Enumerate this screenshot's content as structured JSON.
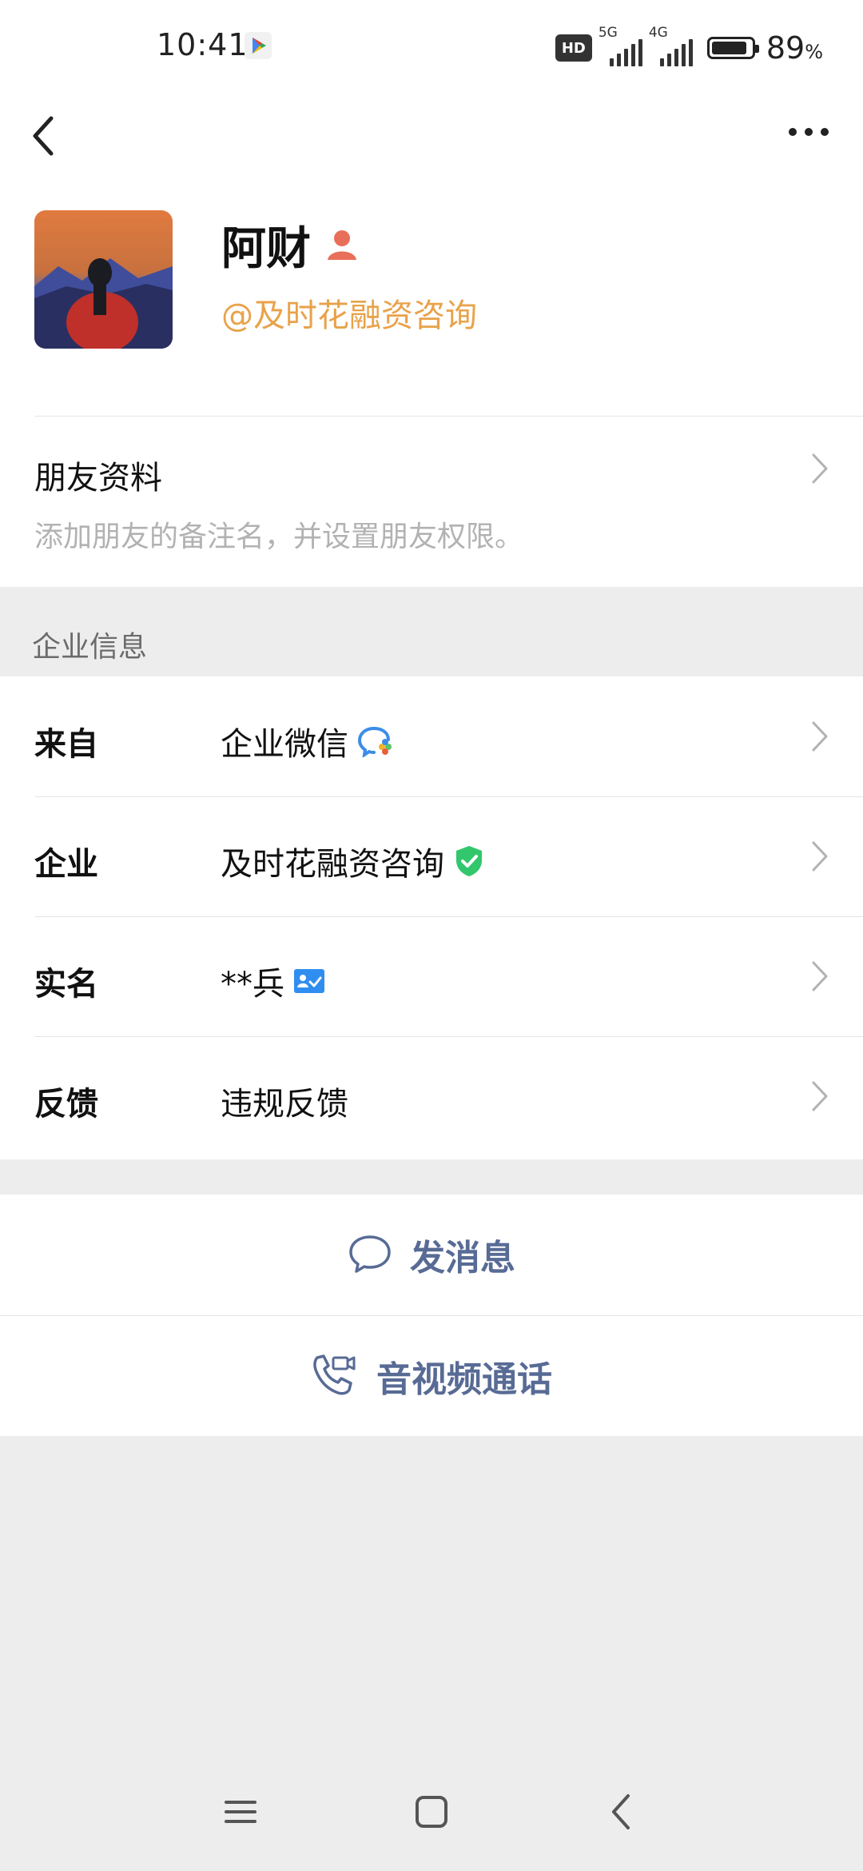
{
  "status_bar": {
    "time": "10:41",
    "hd_label": "HD",
    "signal1_tag": "5G",
    "signal2_tag": "4G",
    "battery_percent": "89",
    "battery_unit": "%",
    "battery_level": 0.89
  },
  "profile": {
    "name": "阿财",
    "corp": "@及时花融资咨询"
  },
  "friend_info": {
    "title": "朋友资料",
    "desc": "添加朋友的备注名，并设置朋友权限。"
  },
  "section_label": "企业信息",
  "info_rows": [
    {
      "key": "来自",
      "value": "企业微信",
      "icon": "wecom-icon"
    },
    {
      "key": "企业",
      "value": "及时花融资咨询",
      "icon": "verified-shield-icon"
    },
    {
      "key": "实名",
      "value": "**兵",
      "icon": "id-card-icon"
    },
    {
      "key": "反馈",
      "value": "违规反馈",
      "icon": ""
    }
  ],
  "actions": {
    "message": "发消息",
    "call": "音视频通话"
  },
  "colors": {
    "accent_link": "#576b95",
    "corp_orange": "#e8a24a",
    "verified_green": "#33c76d",
    "id_blue": "#2f8ef0"
  }
}
